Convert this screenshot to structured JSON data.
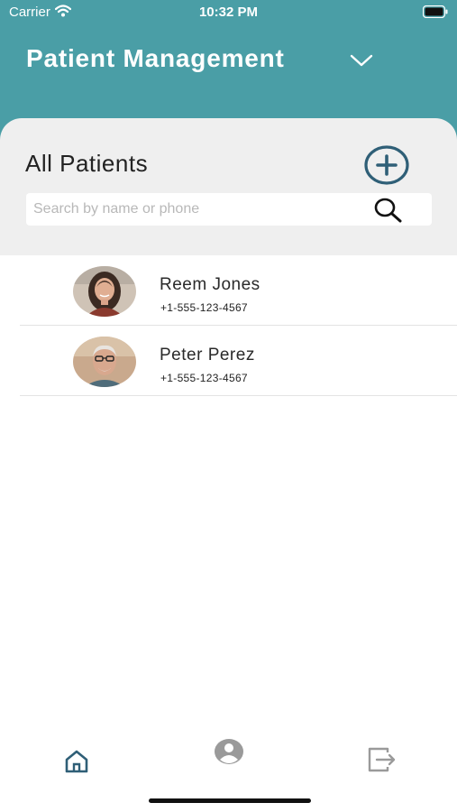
{
  "status_bar": {
    "carrier": "Carrier",
    "time": "10:32 PM",
    "icons": [
      "wifi-icon",
      "battery-icon"
    ]
  },
  "header": {
    "title": "Patient Management",
    "dropdown_icon": "chevron-down-icon"
  },
  "panel": {
    "title": "All Patients",
    "add_icon": "plus-circle-icon",
    "search": {
      "placeholder": "Search by name or phone",
      "value": "",
      "icon": "search-icon"
    }
  },
  "patients": [
    {
      "name": "Reem Jones",
      "phone": "+1-555-123-4567"
    },
    {
      "name": "Peter Perez",
      "phone": "+1-555-123-4567"
    }
  ],
  "tab_bar": {
    "tabs": [
      {
        "icon": "home-icon",
        "active": true
      },
      {
        "icon": "user-icon",
        "active": false
      },
      {
        "icon": "logout-icon",
        "active": false
      }
    ]
  },
  "colors": {
    "header_bg": "#4a9ea6",
    "panel_bg": "#efefef",
    "accent": "#2f5f77",
    "inactive_icon": "#9a9a9a"
  }
}
